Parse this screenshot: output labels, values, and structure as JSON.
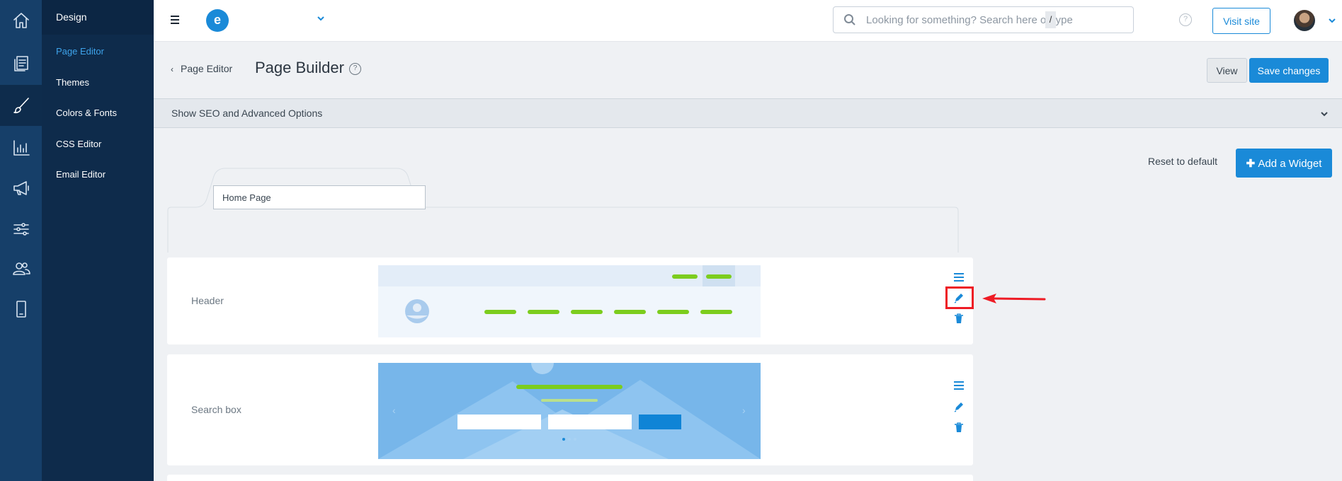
{
  "rail": {
    "items": [
      {
        "icon": "home-icon"
      },
      {
        "icon": "pages-icon"
      },
      {
        "icon": "brush-icon",
        "active": true
      },
      {
        "icon": "analytics-icon"
      },
      {
        "icon": "megaphone-icon"
      },
      {
        "icon": "sliders-icon"
      },
      {
        "icon": "users-icon"
      },
      {
        "icon": "mobile-icon"
      }
    ]
  },
  "subnav": {
    "heading": "Design",
    "items": [
      "Page Editor",
      "Themes",
      "Colors & Fonts",
      "CSS Editor",
      "Email Editor"
    ],
    "active": "Page Editor"
  },
  "topbar": {
    "brand_letter": "e",
    "search_placeholder": "Looking for something? Search here or type",
    "search_shortcut": "/",
    "help_glyph": "?",
    "visit_site": "Visit site"
  },
  "header": {
    "back_label": "Page Editor",
    "title": "Page Builder",
    "help_glyph": "?",
    "view_label": "View",
    "save_label": "Save changes"
  },
  "seo": {
    "label": "Show SEO and Advanced Options"
  },
  "main": {
    "reset_label": "Reset to default",
    "add_widget_label": "Add a Widget",
    "tab_value": "Home Page",
    "widgets": [
      {
        "label": "Header"
      },
      {
        "label": "Search box"
      }
    ]
  },
  "colors": {
    "accent": "#1a8ad8",
    "rail_bg": "#163f69",
    "subnav_bg": "#0e2b4b",
    "annotation": "#ee1c25",
    "preview_green": "#7ccd1e"
  }
}
